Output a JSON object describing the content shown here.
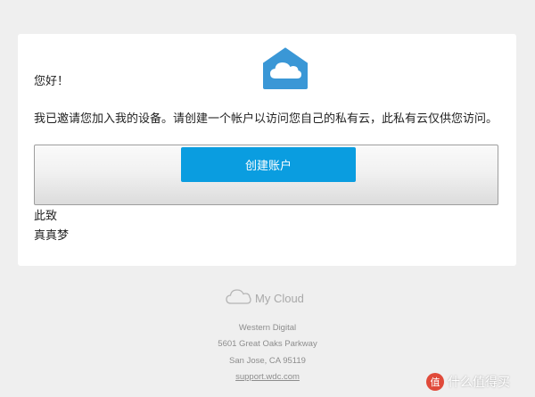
{
  "colors": {
    "accent": "#0a9de0",
    "logo_blue": "#3a97d6",
    "background": "#efefef"
  },
  "email": {
    "greeting": "您好！",
    "message": "我已邀请您加入我的设备。请创建一个帐户以访问您自己的私有云，此私有云仅供您访问。",
    "cta_label": "创建账户",
    "signoff": "此致",
    "sender_name": "真真梦"
  },
  "footer": {
    "brand": "My Cloud",
    "company": "Western Digital",
    "address_line1": "5601 Great Oaks Parkway",
    "address_line2": "San Jose, CA 95119",
    "support_link": "support.wdc.com"
  },
  "watermark": {
    "badge": "值",
    "text": "什么值得买"
  },
  "icons": {
    "header": "cloud-house-icon",
    "footer": "cloud-outline-icon"
  }
}
